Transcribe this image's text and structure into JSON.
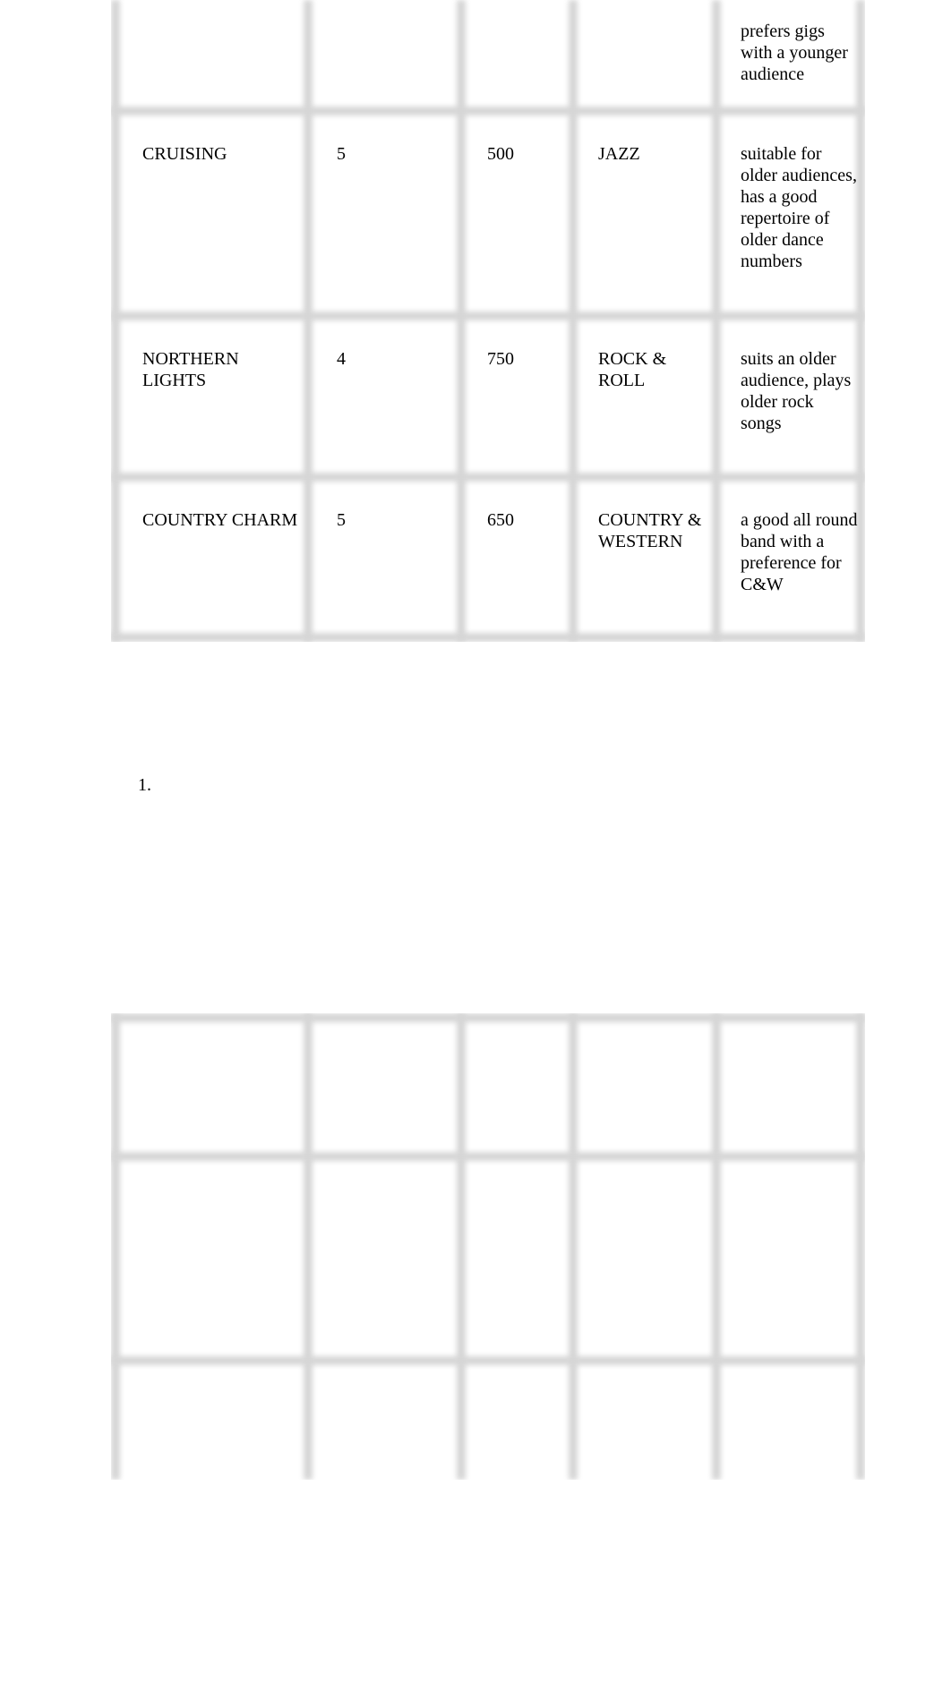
{
  "table1": {
    "rows": [
      {
        "name": "",
        "members": "",
        "fee": "",
        "style": "",
        "notes": "prefers gigs with a younger audience"
      },
      {
        "name": "CRUISING",
        "members": "5",
        "fee": "500",
        "style": "JAZZ",
        "notes": "suitable for older audiences, has a good repertoire of older dance numbers"
      },
      {
        "name": "NORTHERN LIGHTS",
        "members": "4",
        "fee": "750",
        "style": "ROCK & ROLL",
        "notes": "suits an older audience, plays older rock songs"
      },
      {
        "name": "COUNTRY CHARM",
        "members": "5",
        "fee": "650",
        "style": "COUNTRY & WESTERN",
        "notes": "a good all round band with a preference for C&W"
      }
    ]
  },
  "list_marker": "1.",
  "table2": {
    "rows": [
      [
        "",
        "",
        "",
        "",
        ""
      ],
      [
        "",
        "",
        "",
        "",
        ""
      ],
      [
        "",
        "",
        "",
        "",
        ""
      ]
    ]
  }
}
